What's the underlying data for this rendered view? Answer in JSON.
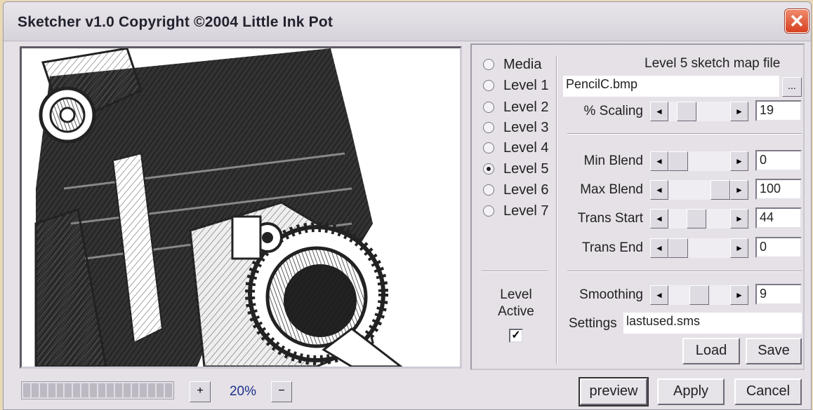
{
  "window": {
    "title": "Sketcher v1.0  Copyright ©2004 Little Ink Pot",
    "close_glyph": "✕"
  },
  "levels": [
    {
      "label": "Media",
      "selected": false
    },
    {
      "label": "Level 1",
      "selected": false
    },
    {
      "label": "Level 2",
      "selected": false
    },
    {
      "label": "Level 3",
      "selected": false
    },
    {
      "label": "Level 4",
      "selected": false
    },
    {
      "label": "Level 5",
      "selected": true
    },
    {
      "label": "Level 6",
      "selected": false
    },
    {
      "label": "Level 7",
      "selected": false
    }
  ],
  "level_active": {
    "label_line1": "Level",
    "label_line2": "Active",
    "checked": true,
    "check_glyph": "✓"
  },
  "sketch_map": {
    "label": "Level 5 sketch map file",
    "value": "PencilC.bmp",
    "browse_label": "..."
  },
  "controls": {
    "scaling": {
      "label": "% Scaling",
      "value": "19"
    },
    "min_blend": {
      "label": "Min Blend",
      "value": "0"
    },
    "max_blend": {
      "label": "Max Blend",
      "value": "100"
    },
    "trans_start": {
      "label": "Trans Start",
      "value": "44"
    },
    "trans_end": {
      "label": "Trans End",
      "value": "0"
    },
    "smoothing": {
      "label": "Smoothing",
      "value": "9"
    }
  },
  "settings": {
    "label": "Settings",
    "value": "lastused.sms",
    "load_label": "Load",
    "save_label": "Save"
  },
  "zoom": {
    "plus": "+",
    "value": "20%",
    "minus": "−"
  },
  "footer": {
    "preview_label": "preview",
    "apply_label": "Apply",
    "cancel_label": "Cancel"
  },
  "arrows": {
    "left": "◄",
    "right": "►"
  },
  "preview_image": {
    "subject": "pencil sketch of a vintage folding camera"
  }
}
